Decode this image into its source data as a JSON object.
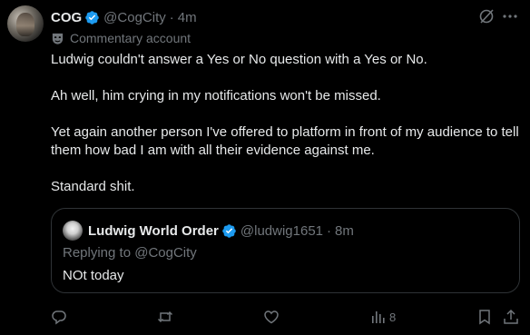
{
  "post": {
    "display_name": "COG",
    "handle": "@CogCity",
    "separator": "·",
    "time": "4m",
    "label": "Commentary account",
    "paragraphs": [
      "Ludwig couldn't answer a Yes or No question with a Yes or No.",
      "Ah well, him crying in my notifications won't be missed.",
      "Yet again another person I've offered to platform in front of my audience to tell them how bad I am with all their evidence against me.",
      "Standard shit."
    ]
  },
  "quote": {
    "display_name": "Ludwig World Order",
    "handle": "@ludwig1651",
    "separator": "·",
    "time": "8m",
    "replying_to": "Replying to @CogCity",
    "text": "NOt today"
  },
  "actions": {
    "views_count": "8"
  },
  "colors": {
    "background": "#000000",
    "text_primary": "#e7e9ea",
    "text_secondary": "#71767b",
    "verified_blue": "#1d9bf0",
    "border": "#2f3336"
  }
}
